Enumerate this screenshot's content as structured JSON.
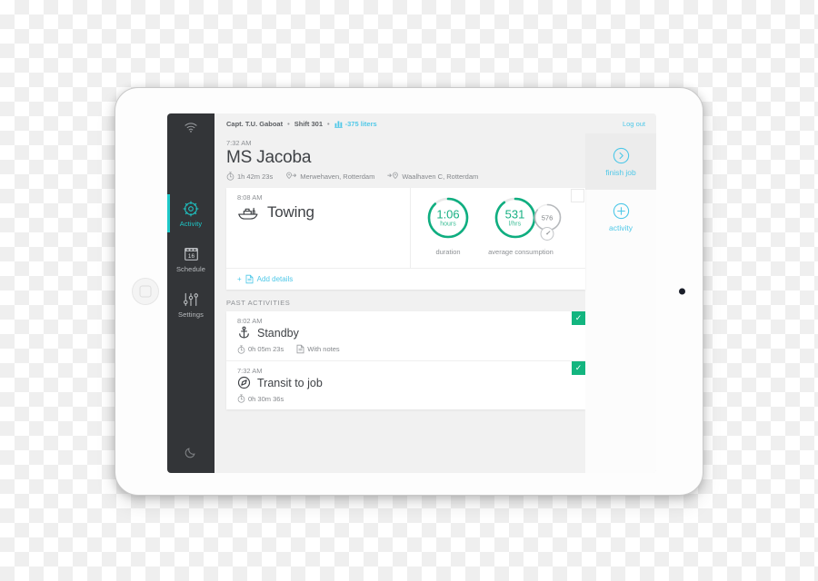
{
  "device": {
    "type": "tablet",
    "orientation": "landscape"
  },
  "topbar": {
    "captain": "Capt. T.U. Gaboat",
    "separator": "•",
    "shift": "Shift 301",
    "fuel_badge": "-375 liters",
    "fuel_icon": "bar-chart-icon",
    "logout_label": "Log out"
  },
  "sidebar": {
    "status_icon": "wifi-icon",
    "items": [
      {
        "label": "Activity",
        "icon": "ships-wheel-icon",
        "active": true
      },
      {
        "label": "Schedule",
        "icon": "calendar-icon",
        "active": false,
        "calendar_day": "16"
      },
      {
        "label": "Settings",
        "icon": "sliders-icon",
        "active": false
      }
    ],
    "night_mode_icon": "moon-icon"
  },
  "job": {
    "start_time": "7:32 AM",
    "title": "MS Jacoba",
    "duration": "1h 42m 23s",
    "duration_icon": "stopwatch-icon",
    "origin": "Merwehaven, Rotterdam",
    "origin_icon": "pin-depart-icon",
    "destination": "Waalhaven C, Rotterdam",
    "destination_icon": "pin-arrive-icon"
  },
  "current_activity": {
    "time": "8:08 AM",
    "title": "Towing",
    "icon": "tugboat-icon",
    "add_details_label": "Add details",
    "add_details_plus": "+",
    "add_details_icon": "document-icon",
    "gauges": [
      {
        "value": "1:06",
        "unit": "hours",
        "label": "duration",
        "percent": 88,
        "color": "#0fae80"
      },
      {
        "value": "531",
        "unit": "l/hrs",
        "label": "average consumption",
        "percent": 90,
        "color": "#0fae80"
      }
    ],
    "mini_gauge": {
      "value": "576",
      "icon": "speedometer-icon",
      "percent": 85,
      "color": "#b7babd"
    }
  },
  "past_activities": {
    "header": "PAST ACTIVITIES",
    "items": [
      {
        "time": "8:02 AM",
        "title": "Standby",
        "icon": "anchor-icon",
        "duration": "0h 05m 23s",
        "duration_icon": "stopwatch-icon",
        "note_label": "With notes",
        "note_icon": "document-icon",
        "checked": true,
        "check_glyph": "✓"
      },
      {
        "time": "7:32 AM",
        "title": "Transit to job",
        "icon": "compass-icon",
        "duration": "0h 30m 36s",
        "duration_icon": "stopwatch-icon",
        "note_label": "",
        "checked": true,
        "check_glyph": "✓"
      }
    ]
  },
  "rail": {
    "finish_job_label": "finish job",
    "finish_job_icon": "chevron-right-circle-icon",
    "add_activity_label": "activity",
    "add_activity_icon": "plus-circle-icon"
  },
  "colors": {
    "accent_cyan": "#4fc8e8",
    "accent_green": "#0fae80",
    "check_green": "#13b57f",
    "sidebar_dark": "#333538",
    "text_dark": "#3f4246",
    "text_muted": "#8d9094"
  }
}
